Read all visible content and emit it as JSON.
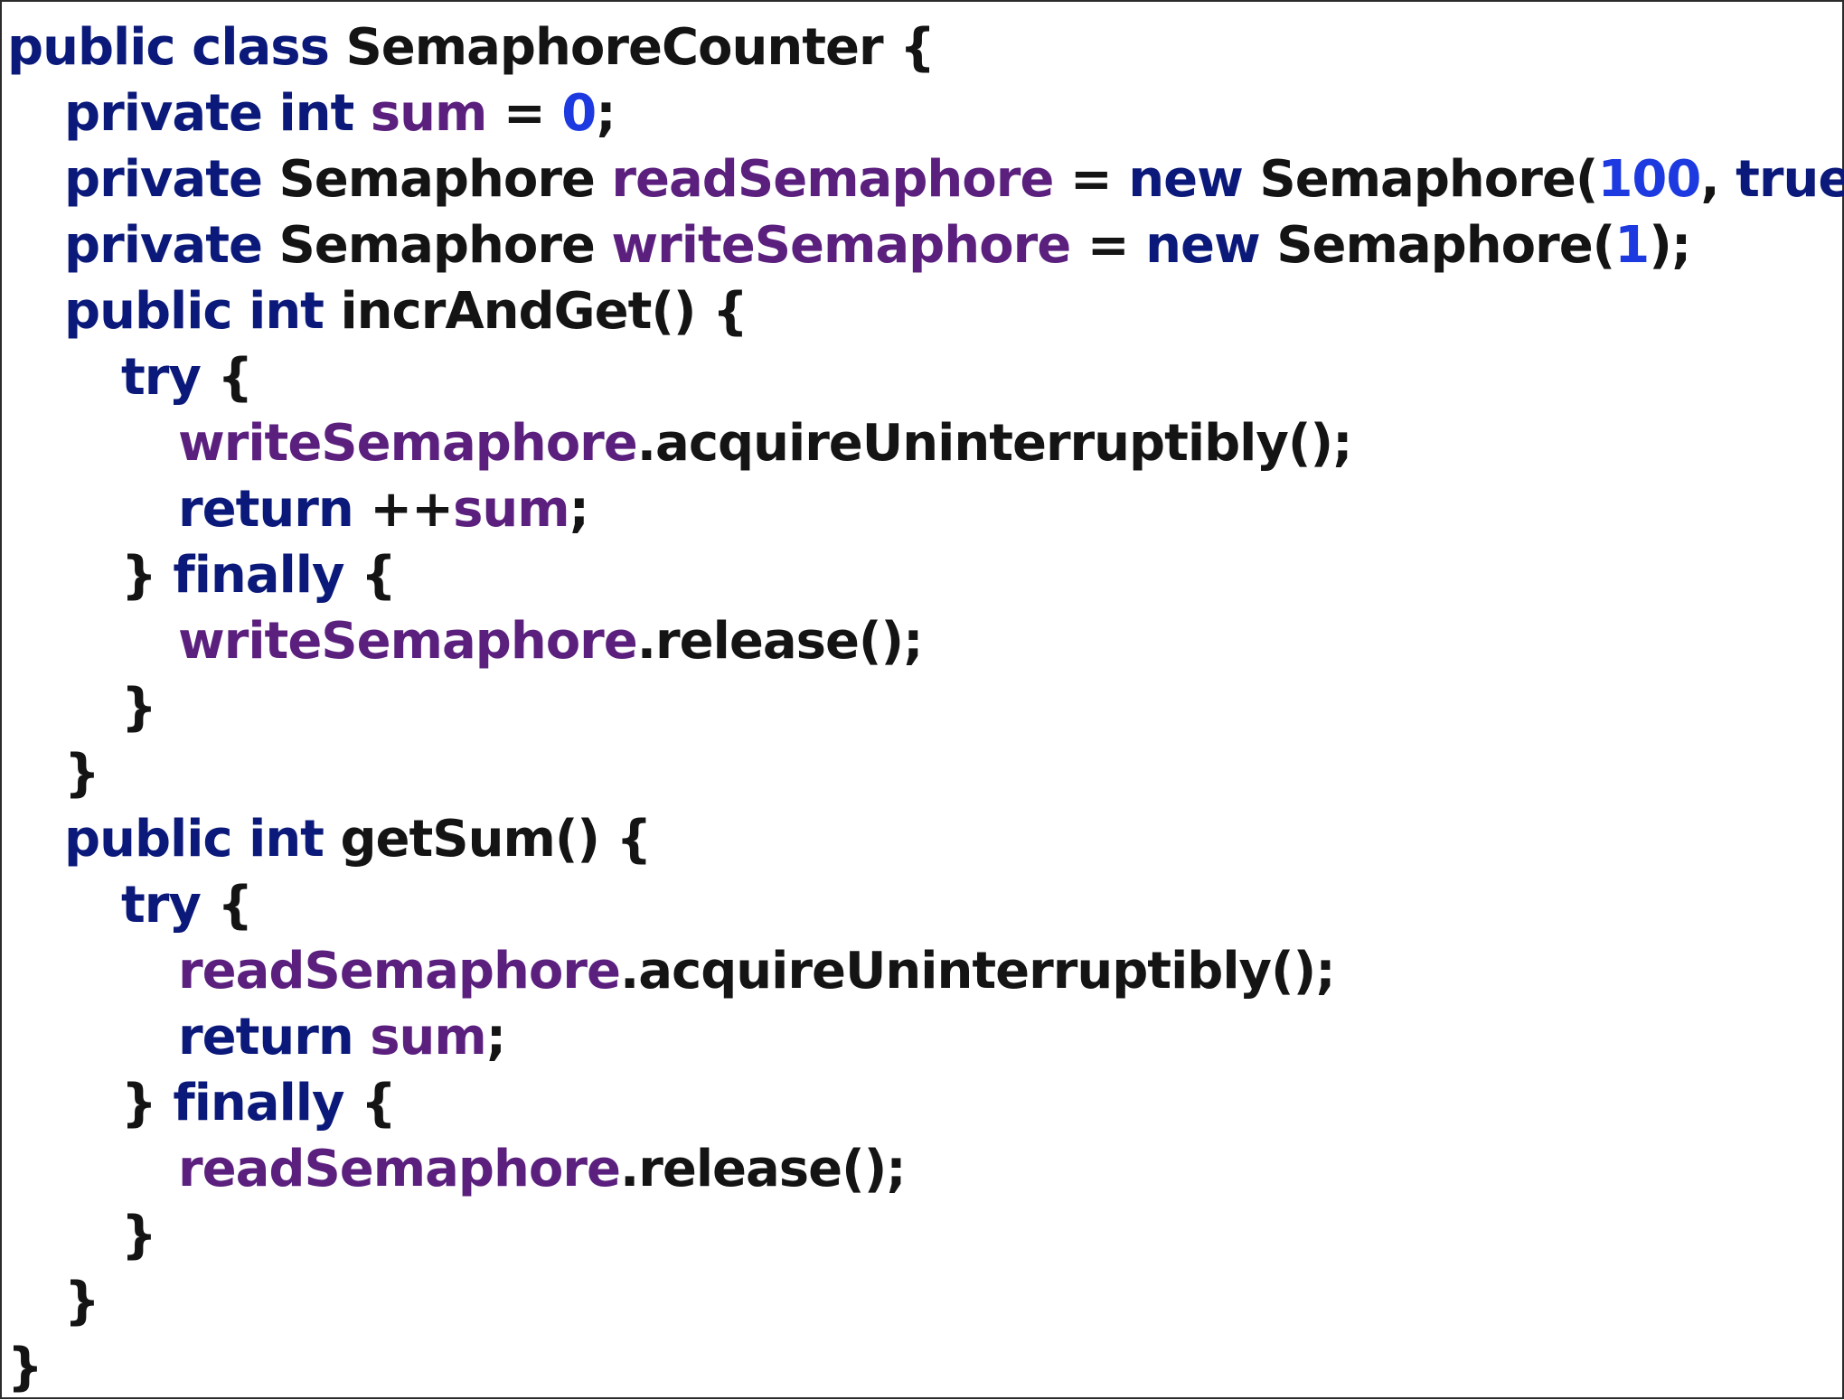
{
  "colors": {
    "keyword": "#0b1a7a",
    "field": "#5b1f7e",
    "number": "#1d3ae0",
    "text": "#141414",
    "border": "#2b2b2b",
    "background": "#ffffff"
  },
  "code": {
    "lines": [
      {
        "indent": 0,
        "tokens": [
          {
            "t": "kw",
            "v": "public class "
          },
          {
            "t": "txt",
            "v": "SemaphoreCounter {"
          }
        ]
      },
      {
        "indent": 1,
        "tokens": [
          {
            "t": "kw",
            "v": "private int "
          },
          {
            "t": "fld",
            "v": "sum"
          },
          {
            "t": "txt",
            "v": " = "
          },
          {
            "t": "num",
            "v": "0"
          },
          {
            "t": "txt",
            "v": ";"
          }
        ]
      },
      {
        "indent": 1,
        "tokens": [
          {
            "t": "kw",
            "v": "private "
          },
          {
            "t": "txt",
            "v": "Semaphore "
          },
          {
            "t": "fld",
            "v": "readSemaphore"
          },
          {
            "t": "txt",
            "v": " = "
          },
          {
            "t": "kw",
            "v": "new "
          },
          {
            "t": "txt",
            "v": "Semaphore("
          },
          {
            "t": "num",
            "v": "100"
          },
          {
            "t": "txt",
            "v": ", "
          },
          {
            "t": "kw",
            "v": "true"
          },
          {
            "t": "txt",
            "v": ");"
          }
        ]
      },
      {
        "indent": 1,
        "tokens": [
          {
            "t": "kw",
            "v": "private "
          },
          {
            "t": "txt",
            "v": "Semaphore "
          },
          {
            "t": "fld",
            "v": "writeSemaphore"
          },
          {
            "t": "txt",
            "v": " = "
          },
          {
            "t": "kw",
            "v": "new "
          },
          {
            "t": "txt",
            "v": "Semaphore("
          },
          {
            "t": "num",
            "v": "1"
          },
          {
            "t": "txt",
            "v": ");"
          }
        ]
      },
      {
        "indent": 1,
        "tokens": [
          {
            "t": "kw",
            "v": "public int "
          },
          {
            "t": "txt",
            "v": "incrAndGet() {"
          }
        ]
      },
      {
        "indent": 2,
        "tokens": [
          {
            "t": "kw",
            "v": "try "
          },
          {
            "t": "txt",
            "v": "{"
          }
        ]
      },
      {
        "indent": 3,
        "tokens": [
          {
            "t": "fld",
            "v": "writeSemaphore"
          },
          {
            "t": "txt",
            "v": ".acquireUninterruptibly();"
          }
        ]
      },
      {
        "indent": 3,
        "tokens": [
          {
            "t": "kw",
            "v": "return "
          },
          {
            "t": "txt",
            "v": "++"
          },
          {
            "t": "fld",
            "v": "sum"
          },
          {
            "t": "txt",
            "v": ";"
          }
        ]
      },
      {
        "indent": 2,
        "tokens": [
          {
            "t": "txt",
            "v": "} "
          },
          {
            "t": "kw",
            "v": "finally "
          },
          {
            "t": "txt",
            "v": "{"
          }
        ]
      },
      {
        "indent": 3,
        "tokens": [
          {
            "t": "fld",
            "v": "writeSemaphore"
          },
          {
            "t": "txt",
            "v": ".release();"
          }
        ]
      },
      {
        "indent": 2,
        "tokens": [
          {
            "t": "txt",
            "v": "}"
          }
        ]
      },
      {
        "indent": 1,
        "tokens": [
          {
            "t": "txt",
            "v": "}"
          }
        ]
      },
      {
        "indent": 1,
        "tokens": [
          {
            "t": "kw",
            "v": "public int "
          },
          {
            "t": "txt",
            "v": "getSum() {"
          }
        ]
      },
      {
        "indent": 2,
        "tokens": [
          {
            "t": "kw",
            "v": "try "
          },
          {
            "t": "txt",
            "v": "{"
          }
        ]
      },
      {
        "indent": 3,
        "tokens": [
          {
            "t": "fld",
            "v": "readSemaphore"
          },
          {
            "t": "txt",
            "v": ".acquireUninterruptibly();"
          }
        ]
      },
      {
        "indent": 3,
        "tokens": [
          {
            "t": "kw",
            "v": "return "
          },
          {
            "t": "fld",
            "v": "sum"
          },
          {
            "t": "txt",
            "v": ";"
          }
        ]
      },
      {
        "indent": 2,
        "tokens": [
          {
            "t": "txt",
            "v": "} "
          },
          {
            "t": "kw",
            "v": "finally "
          },
          {
            "t": "txt",
            "v": "{"
          }
        ]
      },
      {
        "indent": 3,
        "tokens": [
          {
            "t": "fld",
            "v": "readSemaphore"
          },
          {
            "t": "txt",
            "v": ".release();"
          }
        ]
      },
      {
        "indent": 2,
        "tokens": [
          {
            "t": "txt",
            "v": "}"
          }
        ]
      },
      {
        "indent": 1,
        "tokens": [
          {
            "t": "txt",
            "v": "}"
          }
        ]
      },
      {
        "indent": 0,
        "tokens": [
          {
            "t": "txt",
            "v": "}"
          }
        ]
      }
    ]
  }
}
